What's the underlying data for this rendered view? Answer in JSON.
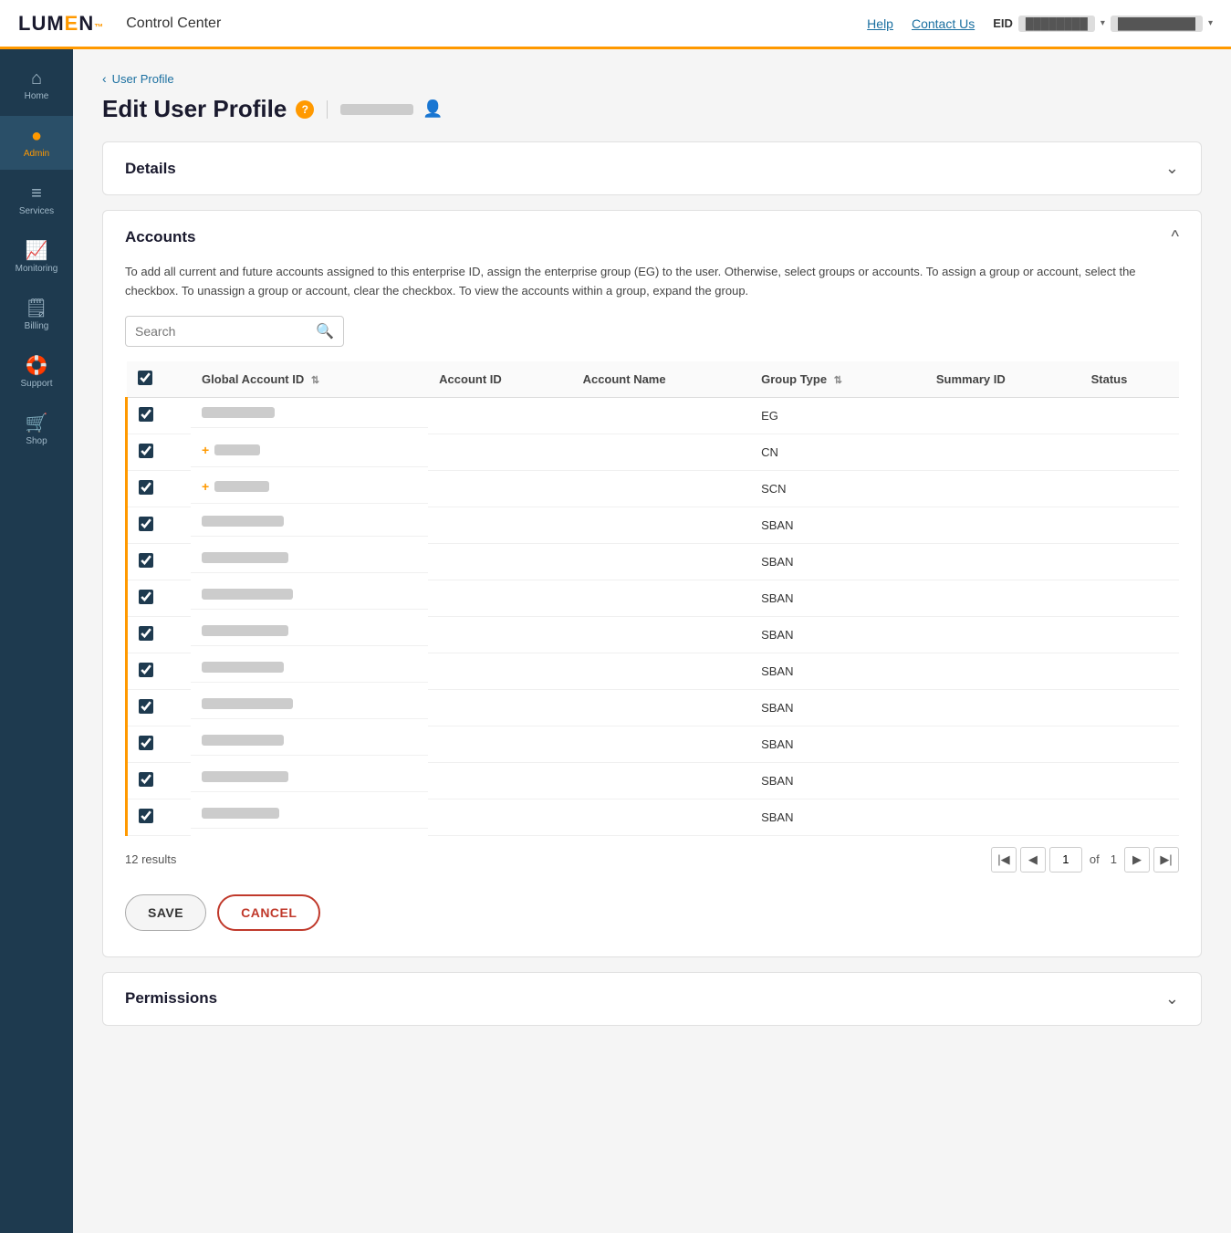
{
  "topNav": {
    "logo": "LUMEN",
    "logoAccent": "■",
    "title": "Control Center",
    "help": "Help",
    "contactUs": "Contact Us",
    "eid_label": "EID",
    "eid_value": "••••••••",
    "user_value": "••••••••••"
  },
  "sidebar": {
    "items": [
      {
        "id": "home",
        "label": "Home",
        "icon": "⌂",
        "active": false
      },
      {
        "id": "admin",
        "label": "Admin",
        "icon": "👤",
        "active": true
      },
      {
        "id": "services",
        "label": "Services",
        "icon": "☰",
        "active": false
      },
      {
        "id": "monitoring",
        "label": "Monitoring",
        "icon": "📈",
        "active": false
      },
      {
        "id": "billing",
        "label": "Billing",
        "icon": "🧾",
        "active": false
      },
      {
        "id": "support",
        "label": "Support",
        "icon": "🛟",
        "active": false
      },
      {
        "id": "shop",
        "label": "Shop",
        "icon": "🛒",
        "active": false
      }
    ]
  },
  "breadcrumb": {
    "parent": "User Profile",
    "arrow": "‹"
  },
  "pageTitle": "Edit User Profile",
  "helpIcon": "?",
  "sections": {
    "details": {
      "title": "Details",
      "collapsed": true
    },
    "accounts": {
      "title": "Accounts",
      "collapsed": false,
      "description": "To add all current and future accounts assigned to this enterprise ID, assign the enterprise group (EG) to the user. Otherwise, select groups or accounts. To assign a group or account, select the checkbox. To unassign a group or account, clear the checkbox. To view the accounts within a group, expand the group.",
      "search": {
        "placeholder": "Search"
      },
      "table": {
        "headers": [
          {
            "id": "checkbox",
            "label": ""
          },
          {
            "id": "global_account_id",
            "label": "Global Account ID",
            "sortable": true
          },
          {
            "id": "account_id",
            "label": "Account ID",
            "sortable": false
          },
          {
            "id": "account_name",
            "label": "Account Name",
            "sortable": false
          },
          {
            "id": "group_type",
            "label": "Group Type",
            "sortable": true
          },
          {
            "id": "summary_id",
            "label": "Summary ID",
            "sortable": false
          },
          {
            "id": "status",
            "label": "Status",
            "sortable": false
          }
        ],
        "rows": [
          {
            "checked": true,
            "global_id_width": 80,
            "expandable": false,
            "group_type": "EG"
          },
          {
            "checked": true,
            "global_id_width": 50,
            "expandable": true,
            "group_type": "CN"
          },
          {
            "checked": true,
            "global_id_width": 60,
            "expandable": true,
            "group_type": "SCN"
          },
          {
            "checked": true,
            "global_id_width": 90,
            "expandable": false,
            "group_type": "SBAN"
          },
          {
            "checked": true,
            "global_id_width": 95,
            "expandable": false,
            "group_type": "SBAN"
          },
          {
            "checked": true,
            "global_id_width": 100,
            "expandable": false,
            "group_type": "SBAN"
          },
          {
            "checked": true,
            "global_id_width": 95,
            "expandable": false,
            "group_type": "SBAN"
          },
          {
            "checked": true,
            "global_id_width": 90,
            "expandable": false,
            "group_type": "SBAN"
          },
          {
            "checked": true,
            "global_id_width": 100,
            "expandable": false,
            "group_type": "SBAN"
          },
          {
            "checked": true,
            "global_id_width": 90,
            "expandable": false,
            "group_type": "SBAN"
          },
          {
            "checked": true,
            "global_id_width": 95,
            "expandable": false,
            "group_type": "SBAN"
          },
          {
            "checked": true,
            "global_id_width": 85,
            "expandable": false,
            "group_type": "SBAN"
          }
        ],
        "results_count": "12 results",
        "pagination": {
          "current_page": "1",
          "total_pages": "1"
        }
      }
    },
    "permissions": {
      "title": "Permissions",
      "collapsed": true
    }
  },
  "actions": {
    "save": "SAVE",
    "cancel": "CANCEL"
  }
}
